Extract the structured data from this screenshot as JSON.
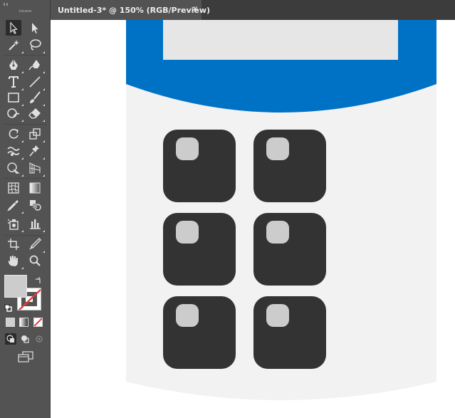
{
  "document_tab": {
    "title": "Untitled-3* @ 150% (RGB/Preview)",
    "close_glyph": "×"
  },
  "toolbar": {
    "collapse_glyph": "‹‹",
    "tools": [
      {
        "name": "selection-tool",
        "icon": "arrow-pointer-icon",
        "selected": true
      },
      {
        "name": "direct-selection-tool",
        "icon": "white-arrow-icon"
      },
      {
        "name": "magic-wand-tool",
        "icon": "magic-wand-icon"
      },
      {
        "name": "lasso-tool",
        "icon": "lasso-icon"
      },
      {
        "name": "pen-tool",
        "icon": "pen-nib-icon"
      },
      {
        "name": "curvature-tool",
        "icon": "curvature-pen-icon"
      },
      {
        "name": "type-tool",
        "icon": "type-t-icon"
      },
      {
        "name": "line-segment-tool",
        "icon": "line-icon"
      },
      {
        "name": "rectangle-tool",
        "icon": "rectangle-icon"
      },
      {
        "name": "paintbrush-tool",
        "icon": "brush-icon"
      },
      {
        "name": "shaper-tool",
        "icon": "shaper-icon"
      },
      {
        "name": "eraser-tool",
        "icon": "eraser-icon"
      },
      {
        "name": "rotate-tool",
        "icon": "rotate-icon"
      },
      {
        "name": "scale-tool",
        "icon": "scale-icon"
      },
      {
        "name": "warp-tool",
        "icon": "warp-icon"
      },
      {
        "name": "free-transform-tool",
        "icon": "pushpin-icon"
      },
      {
        "name": "shape-builder-tool",
        "icon": "shape-builder-icon"
      },
      {
        "name": "perspective-grid-tool",
        "icon": "perspective-grid-icon"
      },
      {
        "name": "mesh-tool",
        "icon": "mesh-icon"
      },
      {
        "name": "gradient-tool",
        "icon": "gradient-icon"
      },
      {
        "name": "eyedropper-tool",
        "icon": "eyedropper-icon"
      },
      {
        "name": "blend-tool",
        "icon": "blend-icon"
      },
      {
        "name": "symbol-sprayer-tool",
        "icon": "symbol-sprayer-icon"
      },
      {
        "name": "column-graph-tool",
        "icon": "column-graph-icon"
      },
      {
        "name": "artboard-tool",
        "icon": "artboard-icon"
      },
      {
        "name": "slice-tool",
        "icon": "slice-knife-icon"
      },
      {
        "name": "hand-tool",
        "icon": "hand-icon"
      },
      {
        "name": "zoom-tool",
        "icon": "magnifier-icon"
      }
    ],
    "fill_color": "#CCCCCC",
    "stroke": "none",
    "color_modes": [
      "color-mode-icon",
      "gradient-mode-icon",
      "none-mode-icon"
    ],
    "draw_modes": [
      "draw-normal-icon",
      "draw-behind-icon",
      "draw-inside-icon"
    ],
    "screen_mode": "screen-mode-icon"
  },
  "artwork": {
    "blue": "#0072C6",
    "body_gray": "#F2F2F2",
    "screen_gray": "#E6E6E6",
    "key_dark": "#333333",
    "key_light": "#CCCCCC",
    "key_count": 6
  },
  "colors": {
    "panel_bg": "#535353",
    "tabbar_bg": "#3C3C3C",
    "canvas_bg": "#FFFFFF"
  }
}
